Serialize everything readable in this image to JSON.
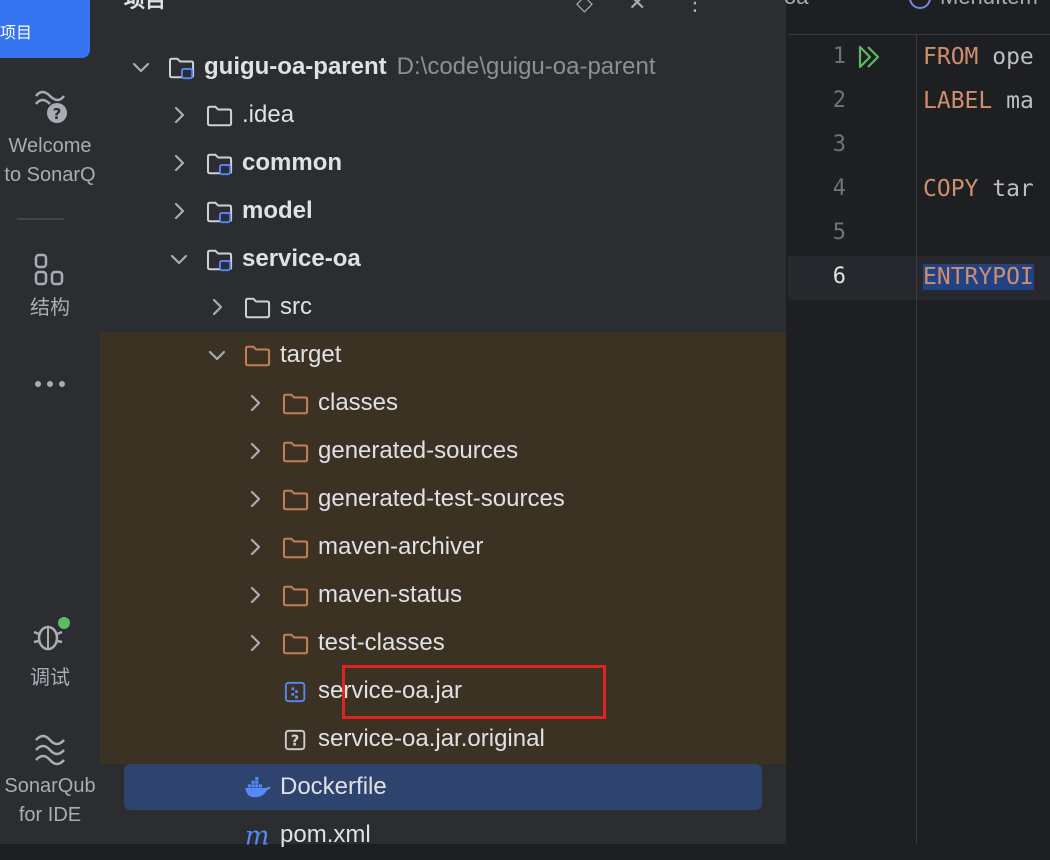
{
  "activity_bar": {
    "items": [
      {
        "label": "项目",
        "icon": "folder-icon",
        "active": true
      },
      {
        "label": "Welcome\nto SonarQ",
        "icon": "sonar-help-icon"
      },
      {
        "label": "结构",
        "icon": "structure-icon"
      },
      {
        "label": "",
        "icon": "more-icon"
      },
      {
        "label": "调试",
        "icon": "debug-bug-icon"
      },
      {
        "label": "SonarQub\nfor IDE",
        "icon": "sonarqube-icon"
      }
    ]
  },
  "project_panel": {
    "title": "项目",
    "tree": [
      {
        "name": "guigu-oa-parent",
        "path": "D:\\code\\guigu-oa-parent",
        "type": "module",
        "bold": true,
        "expanded": true
      },
      {
        "name": ".idea",
        "type": "folder",
        "bold": false
      },
      {
        "name": "common",
        "type": "module",
        "bold": true
      },
      {
        "name": "model",
        "type": "module",
        "bold": true
      },
      {
        "name": "service-oa",
        "type": "module",
        "bold": true,
        "expanded": true
      },
      {
        "name": "src",
        "type": "folder"
      },
      {
        "name": "target",
        "type": "excluded-folder",
        "expanded": true
      },
      {
        "name": "classes",
        "type": "excluded-folder"
      },
      {
        "name": "generated-sources",
        "type": "excluded-folder"
      },
      {
        "name": "generated-test-sources",
        "type": "excluded-folder"
      },
      {
        "name": "maven-archiver",
        "type": "excluded-folder"
      },
      {
        "name": "maven-status",
        "type": "excluded-folder"
      },
      {
        "name": "test-classes",
        "type": "excluded-folder"
      },
      {
        "name": "service-oa.jar",
        "type": "jar"
      },
      {
        "name": "service-oa.jar.original",
        "type": "unknown"
      },
      {
        "name": "Dockerfile",
        "type": "docker",
        "selected": true
      },
      {
        "name": "pom.xml",
        "type": "maven"
      }
    ]
  },
  "editor": {
    "tabs": [
      "oa",
      "MenuItem"
    ],
    "lines": [
      {
        "num": "1",
        "kw": "FROM",
        "rest": " ope"
      },
      {
        "num": "2",
        "kw": "LABEL",
        "rest": " ma"
      },
      {
        "num": "3",
        "kw": "",
        "rest": ""
      },
      {
        "num": "4",
        "kw": "COPY",
        "rest": " tar"
      },
      {
        "num": "5",
        "kw": "",
        "rest": ""
      },
      {
        "num": "6",
        "kw": "ENTRYPOI",
        "rest": ""
      }
    ]
  },
  "colors": {
    "accent": "#3574f0",
    "highlight_box": "#e02424",
    "excluded_folder": "#c77d55",
    "keyword": "#cf8e6d"
  }
}
